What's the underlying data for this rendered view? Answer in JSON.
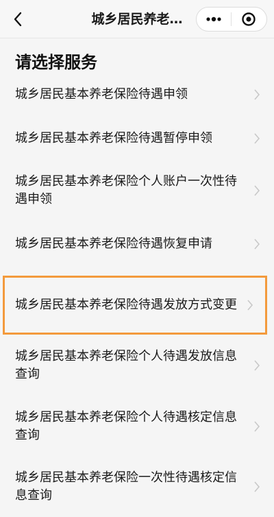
{
  "header": {
    "title": "城乡居民养老…",
    "back_icon": "chevron-left-icon",
    "more_icon": "more-dots-icon",
    "close_icon": "target-close-icon"
  },
  "main": {
    "section_title": "请选择服务",
    "items": [
      {
        "label": "城乡居民基本养老保险待遇申领"
      },
      {
        "label": "城乡居民基本养老保险待遇暂停申领"
      },
      {
        "label": "城乡居民基本养老保险个人账户一次性待遇申领"
      },
      {
        "label": "城乡居民基本养老保险待遇恢复申请"
      },
      {
        "label": "城乡居民基本养老保险待遇发放方式变更",
        "highlighted": true
      },
      {
        "label": "城乡居民基本养老保险个人待遇发放信息查询"
      },
      {
        "label": "城乡居民基本养老保险个人待遇核定信息查询"
      },
      {
        "label": "城乡居民基本养老保险一次性待遇核定信息查询"
      }
    ]
  },
  "colors": {
    "highlight_border": "#f39a3c",
    "chevron": "#c8c8c8"
  }
}
